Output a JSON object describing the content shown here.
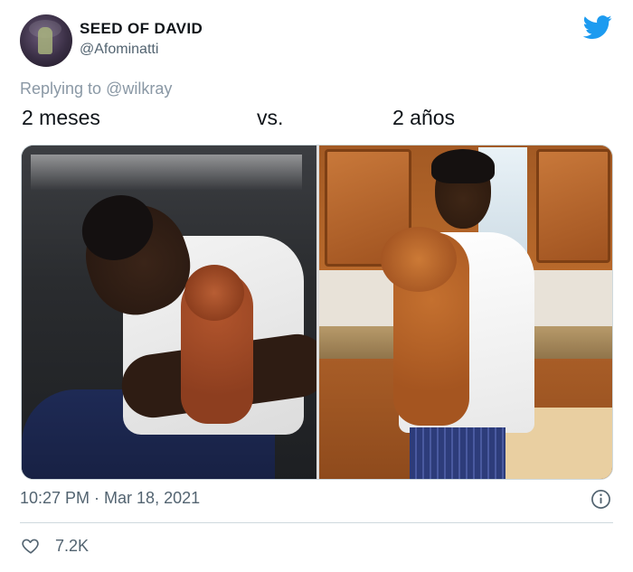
{
  "author": {
    "name": "SEED OF DAVID",
    "handle": "@Afominatti"
  },
  "reply": {
    "prefix": "Replying to ",
    "to": "@wilkray"
  },
  "tweet": {
    "text_left": "2 meses",
    "text_middle": "vs.",
    "text_right": "2 años"
  },
  "media": {
    "left_photo": "photo",
    "right_photo": "photo"
  },
  "meta": {
    "timestamp": "10:27 PM · Mar 18, 2021"
  },
  "stats": {
    "likes": "7.2K"
  },
  "icons": {
    "brand": "twitter-bird-icon",
    "info": "info-icon",
    "like": "heart-icon"
  },
  "colors": {
    "brand_blue": "#1d9bf0",
    "secondary_text": "#536471",
    "divider": "#cfd9de"
  }
}
